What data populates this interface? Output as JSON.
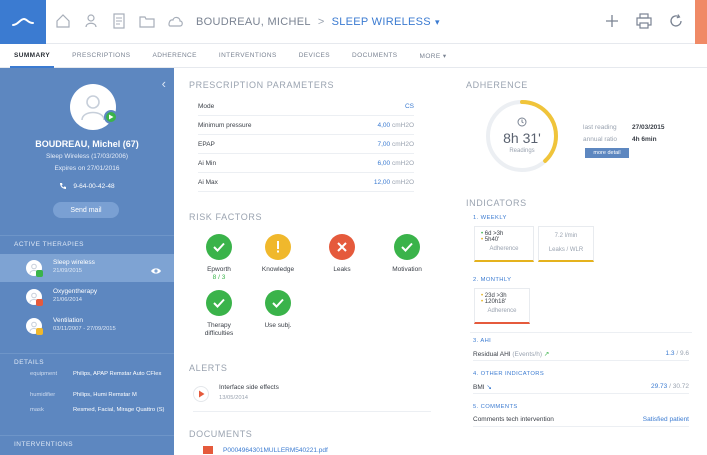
{
  "breadcrumb": {
    "patient": "BOUDREAU, MICHEL",
    "separator": ">",
    "therapy": "SLEEP WIRELESS",
    "caret": "▾"
  },
  "tabs": [
    {
      "label": "SUMMARY"
    },
    {
      "label": "PRESCRIPTIONS"
    },
    {
      "label": "ADHERENCE"
    },
    {
      "label": "INTERVENTIONS"
    },
    {
      "label": "DEVICES"
    },
    {
      "label": "DOCUMENTS"
    },
    {
      "label": "MORE ▾"
    }
  ],
  "patient": {
    "name": "BOUDREAU, Michel (67)",
    "therapy": "Sleep Wireless (17/03/2006)",
    "expires": "Expires on 27/01/2016",
    "phone": "9-64-00-42-48",
    "send_mail": "Send mail"
  },
  "sidebar": {
    "active_therapies_title": "ACTIVE THERAPIES",
    "therapies": [
      {
        "name": "Sleep wireless",
        "date": "21/09/2015",
        "badge_color": "#3ab34a"
      },
      {
        "name": "Oxygentherapy",
        "date": "21/06/2014",
        "badge_color": "#e55a3c"
      },
      {
        "name": "Ventilation",
        "date": "03/11/2007 - 27/09/2015",
        "badge_color": "#f0b82c"
      }
    ],
    "details_title": "DETAILS",
    "details": [
      {
        "k": "equipment",
        "v": "Philips, APAP Remstar Auto CFlex"
      },
      {
        "k": "humidifier",
        "v": "Philips, Humi Remstar M"
      },
      {
        "k": "mask",
        "v": "Resmed, Facial, Mirage Quattro (S)"
      }
    ],
    "interventions_title": "INTERVENTIONS"
  },
  "prescription": {
    "title": "PRESCRIPTION PARAMETERS",
    "rows": [
      {
        "k": "Mode",
        "v": "CS",
        "u": ""
      },
      {
        "k": "Minimum pressure",
        "v": "4,00",
        "u": "cmH2O"
      },
      {
        "k": "EPAP",
        "v": "7,00",
        "u": "cmH2O"
      },
      {
        "k": "Ai Min",
        "v": "6,00",
        "u": "cmH2O"
      },
      {
        "k": "Ai Max",
        "v": "12,00",
        "u": "cmH2O"
      }
    ]
  },
  "risk": {
    "title": "RISK FACTORS",
    "items": [
      {
        "label": "Epworth",
        "sub": "8 / 3",
        "color": "#3ab34a",
        "icon": "check"
      },
      {
        "label": "Knowledge",
        "sub": "",
        "color": "#f0b82c",
        "icon": "exclamation"
      },
      {
        "label": "Leaks",
        "sub": "",
        "color": "#e55a3c",
        "icon": "cross"
      },
      {
        "label": "Motivation",
        "sub": "",
        "color": "#3ab34a",
        "icon": "check"
      },
      {
        "label": "Therapy difficulties",
        "sub": "",
        "color": "#3ab34a",
        "icon": "check"
      },
      {
        "label": "Use subj.",
        "sub": "",
        "color": "#3ab34a",
        "icon": "check"
      }
    ]
  },
  "alerts": {
    "title": "ALERTS",
    "item_title": "Interface side effects",
    "item_date": "13/05/2014"
  },
  "documents": {
    "title": "DOCUMENTS",
    "file": "P0004964301MULLERM540221.pdf"
  },
  "adherence": {
    "title": "ADHERENCE",
    "hours": "8h 31'",
    "sub": "Readings",
    "progress": 0.38,
    "last_reading_label": "last reading",
    "last_reading_value": "27/03/2015",
    "annual_label": "annual ratio",
    "annual_value": "4h 6min",
    "more_detail": "more detail"
  },
  "indicators": {
    "title": "INDICATORS",
    "weekly_title": "1. WEEKLY",
    "weekly_line1": "6d >3h",
    "weekly_line2": "5h40'",
    "weekly_foot": "Adherence",
    "leaks_value": "7.2 l/min",
    "leaks_foot": "Leaks / WLR",
    "monthly_title": "2. MONTHLY",
    "monthly_line1": "23d >3h",
    "monthly_line2": "120h18'",
    "monthly_foot": "Adherence",
    "ahi_title": "3. AHI",
    "ahi_label": "Residual AHI",
    "ahi_unit": "(Events/h)",
    "ahi_trend": "↗",
    "ahi_value": "1.3",
    "ahi_ref": "9.6",
    "other_title": "4. OTHER INDICATORS",
    "bmi_label": "BMI",
    "bmi_trend": "↘",
    "bmi_value": "29.73",
    "bmi_ref": "30.72",
    "comments_title": "5. COMMENTS",
    "comments_label": "Comments tech intervention",
    "comments_value": "Satisfied patient"
  }
}
